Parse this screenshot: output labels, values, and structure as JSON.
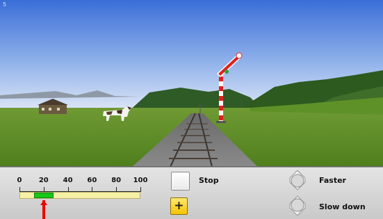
{
  "game": {
    "frame_number": "5"
  },
  "speedometer": {
    "tick_labels": [
      "0",
      "20",
      "40",
      "60",
      "80",
      "100"
    ],
    "scale_max": 100,
    "current_speed": 20,
    "target_range": [
      12,
      28
    ]
  },
  "controls": {
    "stop_label": "Stop",
    "plus_label": "+",
    "faster_label": "Faster",
    "slow_down_label": "Slow down"
  },
  "colors": {
    "speed_range": "#18c718",
    "speed_pointer": "#e00000",
    "speed_bar": "#f6f0a6",
    "plus_button": "#f5c400",
    "signal_arm": "#e02020"
  },
  "icons": {
    "faster": "chevron-up-circle-icon",
    "slow_down": "chevron-down-circle-icon"
  }
}
